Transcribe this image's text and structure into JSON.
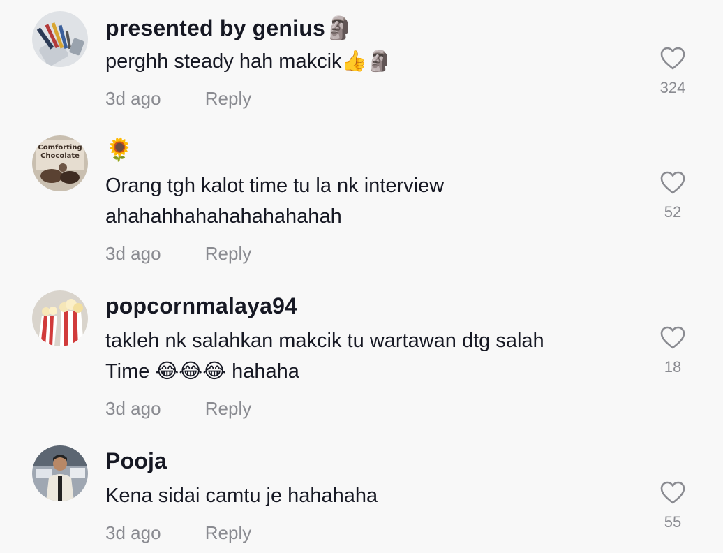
{
  "comments": [
    {
      "username": "presented by genius🗿",
      "text_lines": [
        "perghh steady hah makcik👍🗿"
      ],
      "age": "3d ago",
      "reply_label": "Reply",
      "likes": "324",
      "avatar_icon": "pens-cup-avatar"
    },
    {
      "username": "🌻",
      "text_lines": [
        "Orang tgh kalot time tu la nk interview",
        "ahahahhahahahahahahah"
      ],
      "age": "3d ago",
      "reply_label": "Reply",
      "likes": "52",
      "avatar_icon": "comforting-chocolate-avatar",
      "avatar_text_1": "Comforting",
      "avatar_text_2": "Chocolate"
    },
    {
      "username": "popcornmalaya94",
      "text_lines": [
        "takleh nk salahkan makcik tu wartawan dtg salah",
        "Time 😂😂😂 hahaha"
      ],
      "age": "3d ago",
      "reply_label": "Reply",
      "likes": "18",
      "avatar_icon": "popcorn-avatar"
    },
    {
      "username": "Pooja",
      "text_lines": [
        "Kena sidai camtu je hahahaha"
      ],
      "age": "3d ago",
      "reply_label": "Reply",
      "likes": "55",
      "avatar_icon": "person-avatar"
    }
  ],
  "colors": {
    "background": "#f8f8f8",
    "text": "#161823",
    "muted": "#8a8b91"
  }
}
